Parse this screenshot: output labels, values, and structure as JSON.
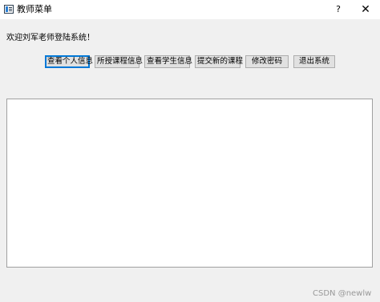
{
  "window": {
    "title": "教师菜单",
    "help_label": "?",
    "close_label": "✕"
  },
  "welcome_text": "欢迎刘军老师登陆系统！",
  "buttons": [
    {
      "label": "查看个人信息"
    },
    {
      "label": "所授课程信息"
    },
    {
      "label": "查看学生信息"
    },
    {
      "label": "提交新的课程"
    },
    {
      "label": "修改密码"
    },
    {
      "label": "退出系统"
    }
  ],
  "output_text": "",
  "watermark": "CSDN @newlw",
  "colors": {
    "background": "#f0f0f0",
    "button_face": "#e1e1e1",
    "focus": "#0078d7"
  },
  "icons": {
    "app": "window-app-icon"
  }
}
